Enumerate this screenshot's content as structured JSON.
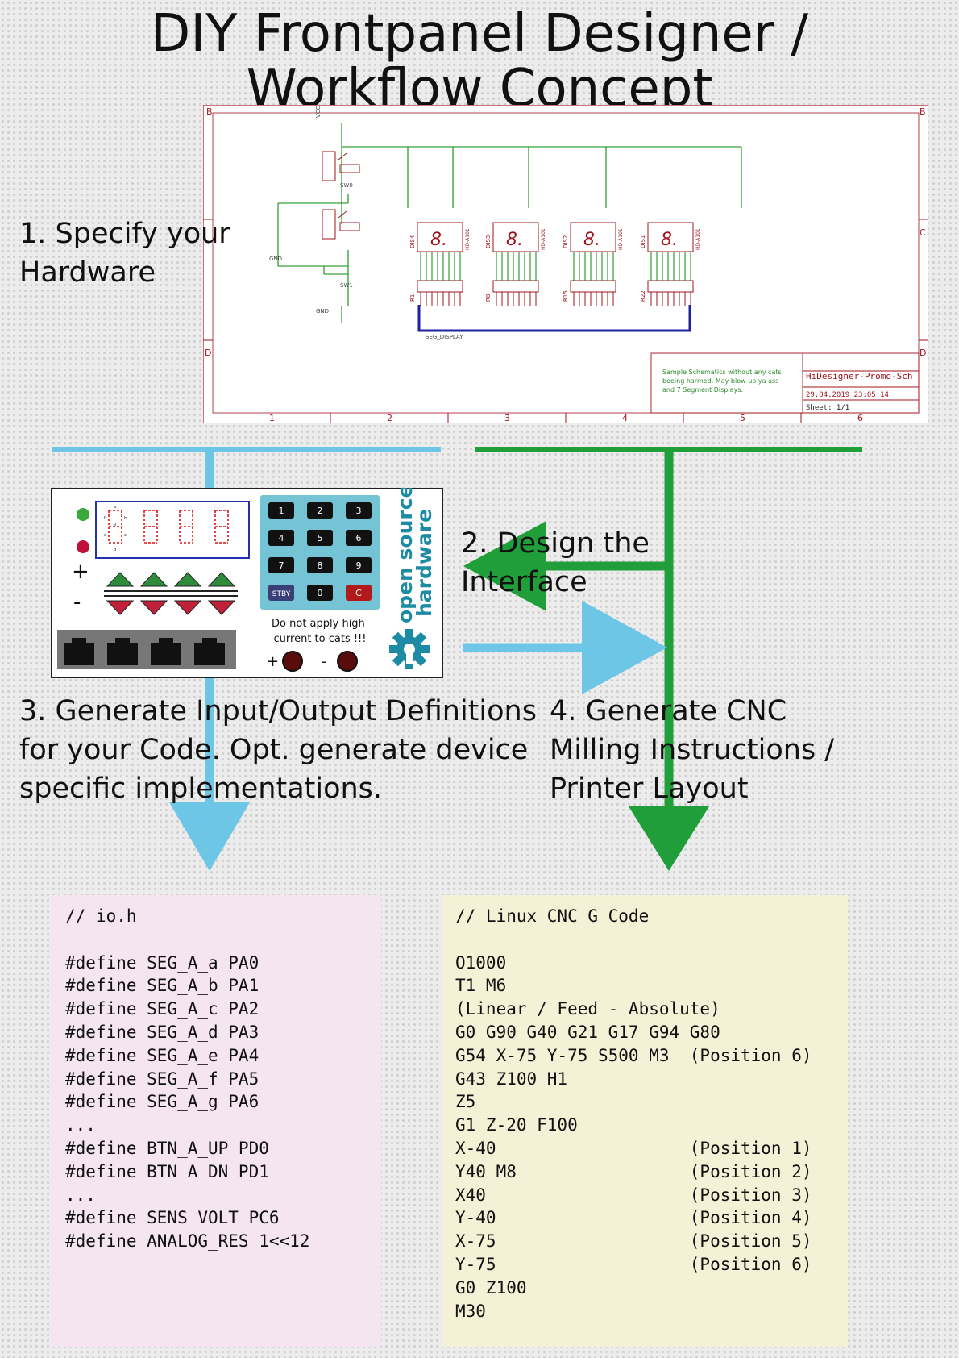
{
  "title": {
    "line1": "DIY Frontpanel Designer /",
    "line2": "Workflow Concept"
  },
  "steps": {
    "s1": "1. Specify your\n    Hardware",
    "s2": "2. Design the\n    Interface",
    "s3": "3. Generate Input/Output Definitions\n    for your Code. Opt. generate device\n    specific implementations.",
    "s4": "4. Generate CNC\n    Milling Instructions /\n    Printer Layout"
  },
  "schematic": {
    "border_rows": [
      "B",
      "C",
      "D"
    ],
    "border_cols": [
      "1",
      "2",
      "3",
      "4",
      "5",
      "6"
    ],
    "net_labels": {
      "vcc": "VCC",
      "sw0": "SW0",
      "sw1": "SW1",
      "gnd_net": "GND",
      "gnd_sym": "GND",
      "bus": "SEG_DISPLAY"
    },
    "displays": [
      {
        "ref": "DIS4",
        "part": "HD-A101",
        "rn": "R1"
      },
      {
        "ref": "DIS3",
        "part": "HD-A101",
        "rn": "R8"
      },
      {
        "ref": "DIS2",
        "part": "HD-A101",
        "rn": "R15"
      },
      {
        "ref": "DIS1",
        "part": "HD-A101",
        "rn": "R22"
      }
    ],
    "digit": "8.",
    "note": "Sample Schematics without any cats\nbeeing harmed. May blow up ya ass\nand 7 Segment Displays.",
    "block_title": "HiDesigner-Promo-Sch",
    "block_date": "29.04.2019  23:05:14",
    "block_sheet": "Sheet: 1/1"
  },
  "panel": {
    "plus": "+",
    "minus": "-",
    "segment_letters": [
      "a",
      "b",
      "c",
      "d",
      "e",
      "f",
      "g"
    ],
    "keys": [
      "1",
      "2",
      "3",
      "4",
      "5",
      "6",
      "7",
      "8",
      "9",
      "STBY",
      "0",
      "C"
    ],
    "warning": "Do not apply high\ncurrent to cats !!!",
    "term_plus": "+",
    "term_minus": "-",
    "osh_text": "open source\nhardware"
  },
  "io_code": "// io.h\n\n#define SEG_A_a PA0\n#define SEG_A_b PA1\n#define SEG_A_c PA2\n#define SEG_A_d PA3\n#define SEG_A_e PA4\n#define SEG_A_f PA5\n#define SEG_A_g PA6\n...\n#define BTN_A_UP PD0\n#define BTN_A_DN PD1\n...\n#define SENS_VOLT PC6\n#define ANALOG_RES 1<<12",
  "gcode": "// Linux CNC G Code\n\nO1000\nT1 M6\n(Linear / Feed - Absolute)\nG0 G90 G40 G21 G17 G94 G80\nG54 X-75 Y-75 S500 M3  (Position 6)\nG43 Z100 H1\nZ5\nG1 Z-20 F100\nX-40                   (Position 1)\nY40 M8                 (Position 2)\nX40                    (Position 3)\nY-40                   (Position 4)\nX-75                   (Position 5)\nY-75                   (Position 6)\nG0 Z100\nM30",
  "colors": {
    "blue_arrow": "#6ec6e6",
    "green_arrow": "#1f9e3a",
    "io_bg": "#f4e5f0",
    "gcode_bg": "#f5f1d6",
    "schematic_line": "#0a8a0a",
    "schematic_part": "#a0141e",
    "bus": "#2020a0",
    "teal": "#1e8ba4",
    "led_green": "#3aa83a",
    "led_red": "#c0103a"
  }
}
